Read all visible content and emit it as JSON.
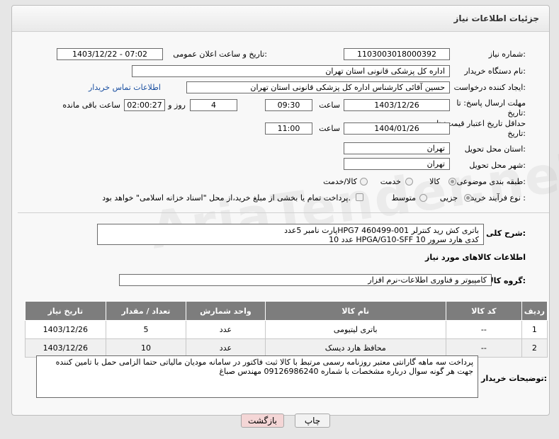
{
  "header": {
    "title": "جزئیات اطلاعات نیاز"
  },
  "fields": {
    "need_number_label": "شماره نیاز:",
    "need_number": "1103003018000392",
    "announce_label": "تاریخ و ساعت اعلان عمومی:",
    "announce_value": "1403/12/22 - 07:02",
    "buyer_org_label": "نام دستگاه خریدار:",
    "buyer_org": "اداره کل پزشکی قانونی استان تهران",
    "creator_label": "ایجاد کننده درخواست:",
    "creator": "حسین آقائی کارشناس اداره کل پزشکی قانونی استان تهران",
    "contact_link": "اطلاعات تماس خریدار",
    "deadline_label_1": "مهلت ارسال پاسخ: تا",
    "deadline_label_2": "تاریخ:",
    "deadline_date": "1403/12/26",
    "time_label": "ساعت",
    "deadline_time": "09:30",
    "days": "4",
    "days_label": "روز و",
    "remaining": "02:00:27",
    "remaining_label": "ساعت باقی مانده",
    "validity_label_1": "حداقل تاریخ اعتبار قیمت: تا",
    "validity_label_2": "تاریخ:",
    "validity_date": "1404/01/26",
    "validity_time": "11:00",
    "province_label": "استان محل تحویل:",
    "province": "تهران",
    "city_label": "شهر محل تحویل:",
    "city": "تهران",
    "category_label": "طبقه بندی موضوعی:",
    "category_options": [
      "کالا",
      "خدمت",
      "کالا/خدمت"
    ],
    "process_label": "نوع فرآیند خرید :",
    "process_options": [
      "جزیی",
      "متوسط"
    ],
    "payment_note": "پرداخت تمام یا بخشی از مبلغ خرید،از محل \"اسناد خزانه اسلامی\" خواهد بود."
  },
  "description": {
    "label": "شرح کلی نیاز:",
    "text": "باتری کش رید کنترلر HPG7 460499-001پارت نامبر 5عدد\nکدی هارد سرور HPGA/G10-SFF 10  عدد 10"
  },
  "goods_info_title": "اطلاعات کالاهای مورد نیاز",
  "goods_group": {
    "label": "گروه کالا:",
    "value": "کامپیوتر و فناوری اطلاعات-نرم افزار"
  },
  "table": {
    "headers": [
      "ردیف",
      "کد کالا",
      "نام کالا",
      "واحد شمارش",
      "تعداد / مقدار",
      "تاریخ نیاز"
    ],
    "rows": [
      [
        "1",
        "--",
        "باتری لیتیومی",
        "عدد",
        "5",
        "1403/12/26"
      ],
      [
        "2",
        "--",
        "محافظ هارد دیسک",
        "عدد",
        "10",
        "1403/12/26"
      ]
    ]
  },
  "buyer_notes": {
    "label": "توضیحات خریدار:",
    "text": "پرداخت سه ماهه گارانتی معتبر روزنامه رسمی مرتبط با کالا ثبت فاکتور در سامانه مودیان مالیاتی حتما الزامی حمل با تامین کننده جهت هر گونه سوال درباره مشخصات با شماره 09126986240 مهندس صباغ"
  },
  "buttons": {
    "print": "چاپ",
    "back": "بازگشت"
  },
  "watermark": "AriaTender.neT",
  "colors": {
    "link": "#1a4fa0",
    "table_header": "#7d7d7d",
    "back_button": "#f4d6d6"
  }
}
